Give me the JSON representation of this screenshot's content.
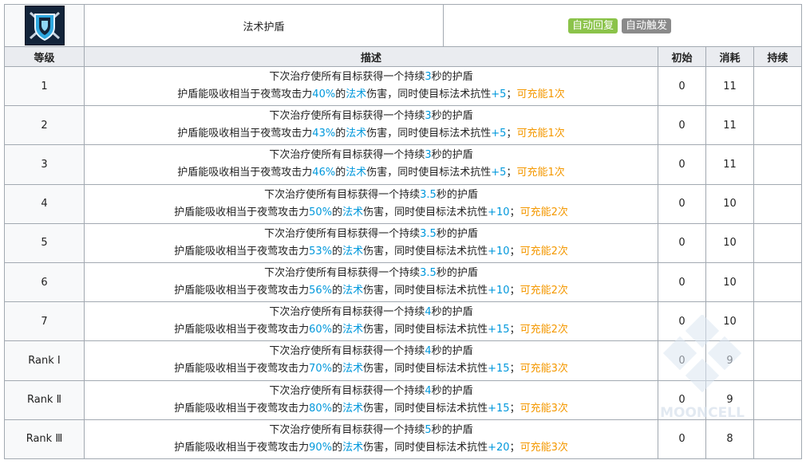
{
  "skill": {
    "icon": "shield-skill-icon",
    "name": "法术护盾",
    "tags": [
      {
        "label": "自动回复",
        "color": "#8bc34a"
      },
      {
        "label": "自动触发",
        "color": "#8a8a8a"
      }
    ]
  },
  "headers": {
    "level": "等级",
    "description": "描述",
    "initial": "初始",
    "cost": "消耗",
    "duration": "持续"
  },
  "rows": [
    {
      "level": "1",
      "line1": {
        "pre": "下次治疗使所有目标获得一个持续",
        "duration": "3",
        "post": "秒的护盾"
      },
      "line2": {
        "pre": "护盾能吸收相当于夜莺攻击力",
        "percent": "40%",
        "mid1": "的",
        "dmg_type": "法术",
        "mid2": "伤害，同时使目标法术抗性",
        "res": "+5",
        "sep": "；",
        "charges": "可充能1次"
      },
      "initial": "0",
      "cost": "11",
      "duration": ""
    },
    {
      "level": "2",
      "line1": {
        "pre": "下次治疗使所有目标获得一个持续",
        "duration": "3",
        "post": "秒的护盾"
      },
      "line2": {
        "pre": "护盾能吸收相当于夜莺攻击力",
        "percent": "43%",
        "mid1": "的",
        "dmg_type": "法术",
        "mid2": "伤害，同时使目标法术抗性",
        "res": "+5",
        "sep": "；",
        "charges": "可充能1次"
      },
      "initial": "0",
      "cost": "11",
      "duration": ""
    },
    {
      "level": "3",
      "line1": {
        "pre": "下次治疗使所有目标获得一个持续",
        "duration": "3",
        "post": "秒的护盾"
      },
      "line2": {
        "pre": "护盾能吸收相当于夜莺攻击力",
        "percent": "46%",
        "mid1": "的",
        "dmg_type": "法术",
        "mid2": "伤害，同时使目标法术抗性",
        "res": "+5",
        "sep": "；",
        "charges": "可充能1次"
      },
      "initial": "0",
      "cost": "11",
      "duration": ""
    },
    {
      "level": "4",
      "line1": {
        "pre": "下次治疗使所有目标获得一个持续",
        "duration": "3.5",
        "post": "秒的护盾"
      },
      "line2": {
        "pre": "护盾能吸收相当于夜莺攻击力",
        "percent": "50%",
        "mid1": "的",
        "dmg_type": "法术",
        "mid2": "伤害，同时使目标法术抗性",
        "res": "+10",
        "sep": "；",
        "charges": "可充能2次"
      },
      "initial": "0",
      "cost": "10",
      "duration": ""
    },
    {
      "level": "5",
      "line1": {
        "pre": "下次治疗使所有目标获得一个持续",
        "duration": "3.5",
        "post": "秒的护盾"
      },
      "line2": {
        "pre": "护盾能吸收相当于夜莺攻击力",
        "percent": "53%",
        "mid1": "的",
        "dmg_type": "法术",
        "mid2": "伤害，同时使目标法术抗性",
        "res": "+10",
        "sep": "；",
        "charges": "可充能2次"
      },
      "initial": "0",
      "cost": "10",
      "duration": ""
    },
    {
      "level": "6",
      "line1": {
        "pre": "下次治疗使所有目标获得一个持续",
        "duration": "3.5",
        "post": "秒的护盾"
      },
      "line2": {
        "pre": "护盾能吸收相当于夜莺攻击力",
        "percent": "56%",
        "mid1": "的",
        "dmg_type": "法术",
        "mid2": "伤害，同时使目标法术抗性",
        "res": "+10",
        "sep": "；",
        "charges": "可充能2次"
      },
      "initial": "0",
      "cost": "10",
      "duration": ""
    },
    {
      "level": "7",
      "line1": {
        "pre": "下次治疗使所有目标获得一个持续",
        "duration": "4",
        "post": "秒的护盾"
      },
      "line2": {
        "pre": "护盾能吸收相当于夜莺攻击力",
        "percent": "60%",
        "mid1": "的",
        "dmg_type": "法术",
        "mid2": "伤害，同时使目标法术抗性",
        "res": "+15",
        "sep": "；",
        "charges": "可充能2次"
      },
      "initial": "0",
      "cost": "10",
      "duration": ""
    },
    {
      "level": "Rank Ⅰ",
      "line1": {
        "pre": "下次治疗使所有目标获得一个持续",
        "duration": "4",
        "post": "秒的护盾"
      },
      "line2": {
        "pre": "护盾能吸收相当于夜莺攻击力",
        "percent": "70%",
        "mid1": "的",
        "dmg_type": "法术",
        "mid2": "伤害，同时使目标法术抗性",
        "res": "+15",
        "sep": "；",
        "charges": "可充能3次"
      },
      "initial": "0",
      "cost": "9",
      "duration": ""
    },
    {
      "level": "Rank Ⅱ",
      "line1": {
        "pre": "下次治疗使所有目标获得一个持续",
        "duration": "4",
        "post": "秒的护盾"
      },
      "line2": {
        "pre": "护盾能吸收相当于夜莺攻击力",
        "percent": "80%",
        "mid1": "的",
        "dmg_type": "法术",
        "mid2": "伤害，同时使目标法术抗性",
        "res": "+15",
        "sep": "；",
        "charges": "可充能3次"
      },
      "initial": "0",
      "cost": "9",
      "duration": ""
    },
    {
      "level": "Rank Ⅲ",
      "line1": {
        "pre": "下次治疗使所有目标获得一个持续",
        "duration": "5",
        "post": "秒的护盾"
      },
      "line2": {
        "pre": "护盾能吸收相当于夜莺攻击力",
        "percent": "90%",
        "mid1": "的",
        "dmg_type": "法术",
        "mid2": "伤害，同时使目标法术抗性",
        "res": "+20",
        "sep": "；",
        "charges": "可充能3次"
      },
      "initial": "0",
      "cost": "8",
      "duration": ""
    }
  ],
  "colors": {
    "highlight_blue": "#0098dc",
    "highlight_orange": "#f49800",
    "header_bg": "#eaecf0",
    "level_bg": "#f8f9fa",
    "border": "#a2a9b1"
  },
  "watermark": {
    "text": "MOONCELL"
  }
}
